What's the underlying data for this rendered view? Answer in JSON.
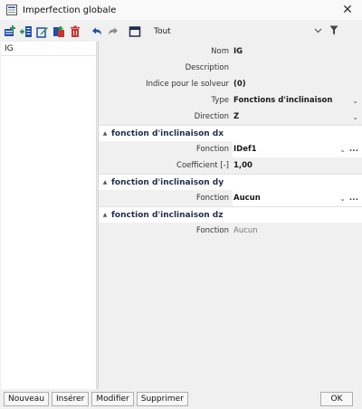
{
  "window": {
    "title": "Imperfection globale",
    "close_icon": "close-icon"
  },
  "toolbar": {
    "filter_label": "Tout",
    "icons": [
      "new-item-icon",
      "insert-item-icon",
      "edit-item-icon",
      "copy-item-icon",
      "delete-item-icon",
      "undo-icon",
      "redo-icon",
      "table-view-icon"
    ],
    "dropdown_icon": "chevron-down-icon",
    "filter_icon": "filter-icon"
  },
  "list": {
    "items": [
      {
        "label": "IG"
      }
    ]
  },
  "properties": {
    "nom": {
      "label": "Nom",
      "value": "IG"
    },
    "description": {
      "label": "Description",
      "value": ""
    },
    "indice": {
      "label": "Indice pour le solveur",
      "value": "(0)"
    },
    "type": {
      "label": "Type",
      "value": "Fonctions d'inclinaison"
    },
    "direction": {
      "label": "Direction",
      "value": "Z"
    }
  },
  "sections": {
    "dx": {
      "title": "fonction d'inclinaison dx",
      "fonction": {
        "label": "Fonction",
        "value": "IDef1"
      },
      "coefficient": {
        "label": "Coefficient [-]",
        "value": "1,00"
      }
    },
    "dy": {
      "title": "fonction d'inclinaison dy",
      "fonction": {
        "label": "Fonction",
        "value": "Aucun"
      }
    },
    "dz": {
      "title": "fonction d'inclinaison dz",
      "fonction": {
        "label": "Fonction",
        "value": "Aucun"
      }
    }
  },
  "buttons": {
    "nouveau": "Nouveau",
    "inserer": "Insérer",
    "modifier": "Modifier",
    "supprimer": "Supprimer",
    "ok": "OK"
  },
  "glyphs": {
    "dropdown": "⌄",
    "ellipsis": "...",
    "collapse": "▲",
    "close": "✕"
  },
  "colors": {
    "accent_blue": "#1f4fa8",
    "delete_red": "#d0312d",
    "green": "#2e9a4a",
    "section_title": "#1f2d4e"
  }
}
